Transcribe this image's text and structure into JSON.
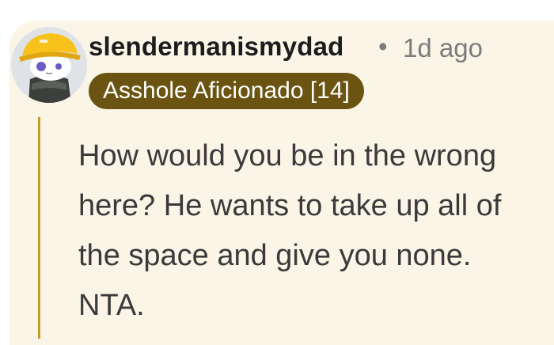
{
  "comment": {
    "author": "slendermanismydad",
    "separator": "•",
    "timestamp": "1d ago",
    "flair": "Asshole Aficionado [14]",
    "body": "How would you be in the wrong here? He wants to take up all of the space and give you none. NTA."
  },
  "colors": {
    "card_background": "#fbf5e8",
    "thread_line": "#c89a2b",
    "flair_background": "#6b5412",
    "flair_text": "#ffffff",
    "username": "#1c1c1c",
    "meta_text": "#7c7c7c",
    "body_text": "#3a3a3a"
  },
  "icons": {
    "avatar": "snoo-avatar-yellow-bucket-hat"
  }
}
